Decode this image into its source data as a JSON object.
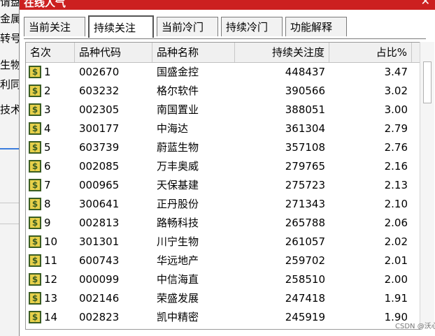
{
  "window": {
    "title": "在线人气"
  },
  "background": {
    "lines": [
      "请盘",
      "金属",
      "转号",
      "生物",
      "利同",
      "技术"
    ]
  },
  "tabs": [
    {
      "label": "当前关注"
    },
    {
      "label": "持续关注"
    },
    {
      "label": "当前冷门"
    },
    {
      "label": "持续冷门"
    },
    {
      "label": "功能解释"
    }
  ],
  "active_tab": "持续关注",
  "table": {
    "columns": [
      "名次",
      "品种代码",
      "品种名称",
      "持续关注度",
      "占比%"
    ],
    "rows": [
      {
        "rank": "1",
        "code": "002670",
        "name": "国盛金控",
        "attention": "448437",
        "pct": "3.47"
      },
      {
        "rank": "2",
        "code": "603232",
        "name": "格尔软件",
        "attention": "390566",
        "pct": "3.02"
      },
      {
        "rank": "3",
        "code": "002305",
        "name": "南国置业",
        "attention": "388051",
        "pct": "3.00"
      },
      {
        "rank": "4",
        "code": "300177",
        "name": "中海达",
        "attention": "361304",
        "pct": "2.79"
      },
      {
        "rank": "5",
        "code": "603739",
        "name": "蔚蓝生物",
        "attention": "357108",
        "pct": "2.76"
      },
      {
        "rank": "6",
        "code": "002085",
        "name": "万丰奥威",
        "attention": "279765",
        "pct": "2.16"
      },
      {
        "rank": "7",
        "code": "000965",
        "name": "天保基建",
        "attention": "275723",
        "pct": "2.13"
      },
      {
        "rank": "8",
        "code": "300641",
        "name": "正丹股份",
        "attention": "271343",
        "pct": "2.10"
      },
      {
        "rank": "9",
        "code": "002813",
        "name": "路畅科技",
        "attention": "265788",
        "pct": "2.06"
      },
      {
        "rank": "10",
        "code": "301301",
        "name": "川宁生物",
        "attention": "261057",
        "pct": "2.02"
      },
      {
        "rank": "11",
        "code": "600743",
        "name": "华远地产",
        "attention": "259702",
        "pct": "2.01"
      },
      {
        "rank": "12",
        "code": "000099",
        "name": "中信海直",
        "attention": "258510",
        "pct": "2.00"
      },
      {
        "rank": "13",
        "code": "002146",
        "name": "荣盛发展",
        "attention": "247418",
        "pct": "1.91"
      },
      {
        "rank": "14",
        "code": "002823",
        "name": "凯中精密",
        "attention": "245919",
        "pct": "1.90"
      }
    ]
  },
  "icons": {
    "row_icon": "dollar-icon",
    "close": "close-icon"
  },
  "colors": {
    "titlebar": "#cc2020",
    "icon_fill": "#e7d04a",
    "icon_border": "#3a5d23"
  },
  "watermark": "CSDN @沃心"
}
